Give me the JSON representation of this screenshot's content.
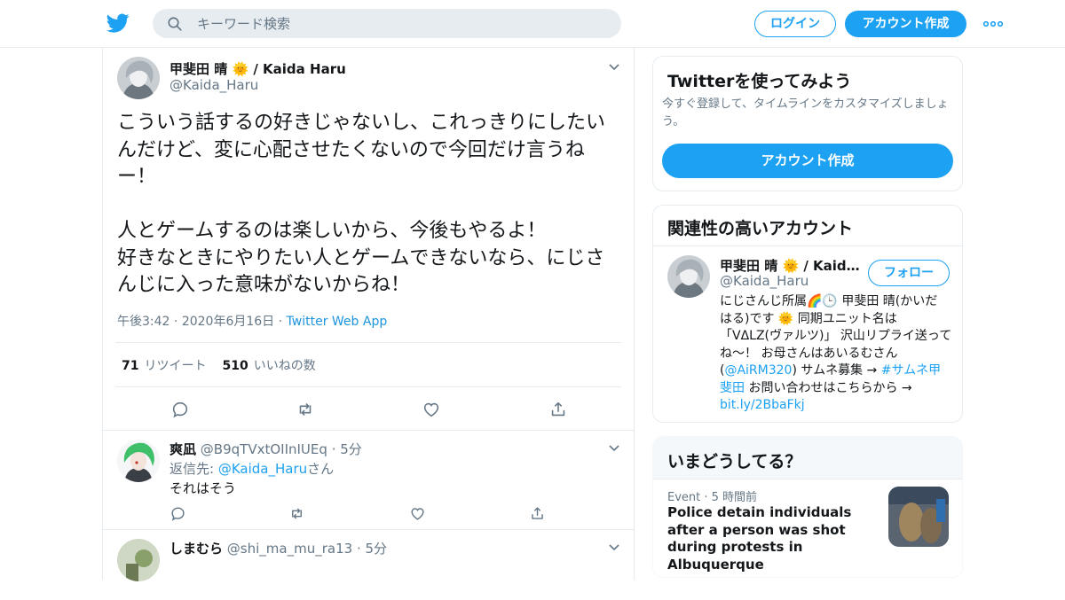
{
  "header": {
    "search_placeholder": "キーワード検索",
    "login_label": "ログイン",
    "signup_label": "アカウント作成",
    "accent_color": "#1da1f2"
  },
  "tweet": {
    "display_name": "甲斐田 晴 🌞 / Kaida Haru",
    "handle": "@Kaida_Haru",
    "text": "こういう話するの好きじゃないし、これっきりにしたいんだけど、変に心配させたくないので今回だけ言うねー！\n\n人とゲームするのは楽しいから、今後もやるよ！\n好きなときにやりたい人とゲームできないなら、にじさんじに入った意味がないからね！",
    "time": "午後3:42",
    "date": "2020年6月16日",
    "source": "Twitter Web App",
    "retweet_count": "71",
    "retweet_label": "リツイート",
    "like_count": "510",
    "like_label": "いいねの数"
  },
  "replies": [
    {
      "display_name": "爽凪",
      "handle": "@B9qTVxtOIInIUEq",
      "age": "5分",
      "reply_to_prefix": "返信先: ",
      "reply_to_handle": "@Kaida_Haru",
      "reply_to_suffix": "さん",
      "text": "それはそう"
    },
    {
      "display_name": "しまむら",
      "handle": "@shi_ma_mu_ra13",
      "age": "5分"
    }
  ],
  "sidebar": {
    "signup_card": {
      "title": "Twitterを使ってみよう",
      "description": "今すぐ登録して、タイムラインをカスタマイズしましょう。",
      "button": "アカウント作成"
    },
    "related_card": {
      "title": "関連性の高いアカウント",
      "display_name": "甲斐田 晴 🌞 / Kaida Haru",
      "handle": "@Kaida_Haru",
      "follow_label": "フォロー",
      "bio_part1": "にじさんじ所属🌈🕒 甲斐田 晴(かいだ はる)です 🌞 同期ユニット名は「VΔLZ(ヴァルツ)」 沢山リプライ送ってね～！ お母さんはあいるむさん(",
      "bio_mention": "@AiRM320",
      "bio_part2": ") サムネ募集 → ",
      "bio_hashtag": "#サムネ甲斐田",
      "bio_part3": " お問い合わせはこちらから → ",
      "bio_link": "bit.ly/2BbaFkj"
    },
    "trends_card": {
      "title": "いまどうしてる？",
      "event_label": "Event",
      "event_age": "5 時間前",
      "headline": "Police detain individuals after a person was shot during protests in Albuquerque"
    }
  }
}
